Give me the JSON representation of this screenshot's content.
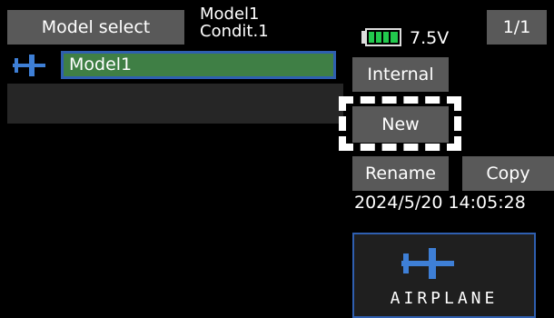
{
  "header": {
    "title": "Model select",
    "model_name": "Model1",
    "condition": "Condit.1",
    "voltage": "7.5V",
    "page": "1/1"
  },
  "model_list": {
    "items": [
      {
        "name": "Model1",
        "type_icon": "airplane-icon",
        "selected": true
      }
    ]
  },
  "buttons": {
    "internal": "Internal",
    "new": "New",
    "rename": "Rename",
    "copy": "Copy"
  },
  "datetime": "2024/5/20 14:05:28",
  "model_type": {
    "label": "AIRPLANE",
    "icon": "airplane-icon"
  },
  "colors": {
    "accent_blue": "#2f5fb0",
    "selected_green": "#3f7f45",
    "button_gray": "#595959",
    "battery_green": "#22c94d"
  }
}
